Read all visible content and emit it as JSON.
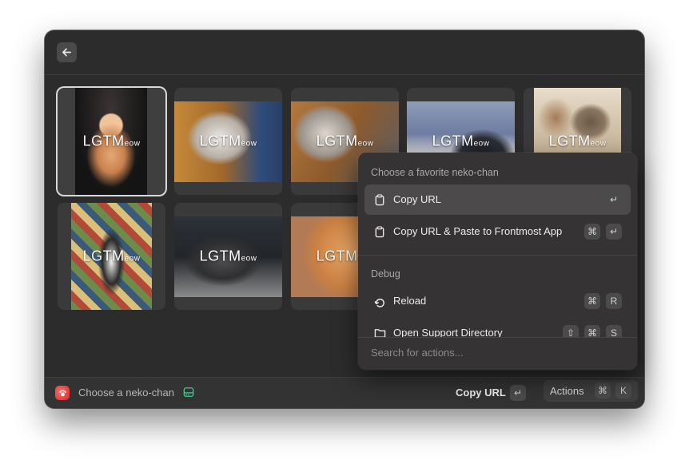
{
  "header": {
    "back_icon": "arrow-left-icon"
  },
  "grid": {
    "overlay_main": "LGTM",
    "overlay_sub": "eow",
    "tiles": [
      {
        "id": 1,
        "selected": true
      },
      {
        "id": 2,
        "selected": false
      },
      {
        "id": 3,
        "selected": false
      },
      {
        "id": 4,
        "selected": false
      },
      {
        "id": 5,
        "selected": false
      },
      {
        "id": 6,
        "selected": false
      },
      {
        "id": 7,
        "selected": false
      },
      {
        "id": 8,
        "selected": false
      }
    ]
  },
  "popover": {
    "section1_title": "Choose a favorite neko-chan",
    "items1": [
      {
        "label": "Copy URL",
        "icon": "clipboard-icon",
        "keys": [
          "↵"
        ]
      },
      {
        "label": "Copy URL & Paste to Frontmost App",
        "icon": "clipboard-icon",
        "keys": [
          "⌘",
          "↵"
        ]
      }
    ],
    "section2_title": "Debug",
    "items2": [
      {
        "label": "Reload",
        "icon": "reload-icon",
        "keys": [
          "⌘",
          "R"
        ]
      },
      {
        "label": "Open Support Directory",
        "icon": "folder-icon",
        "keys": [
          "⇧",
          "⌘",
          "S"
        ]
      }
    ],
    "search_placeholder": "Search for actions..."
  },
  "footer": {
    "title": "Choose a neko-chan",
    "primary_action": "Copy URL",
    "primary_key": "↵",
    "actions_label": "Actions",
    "actions_keys": [
      "⌘",
      "K"
    ]
  },
  "colors": {
    "app_icon": "#e03a3a",
    "badge": "#3ecf8e"
  }
}
